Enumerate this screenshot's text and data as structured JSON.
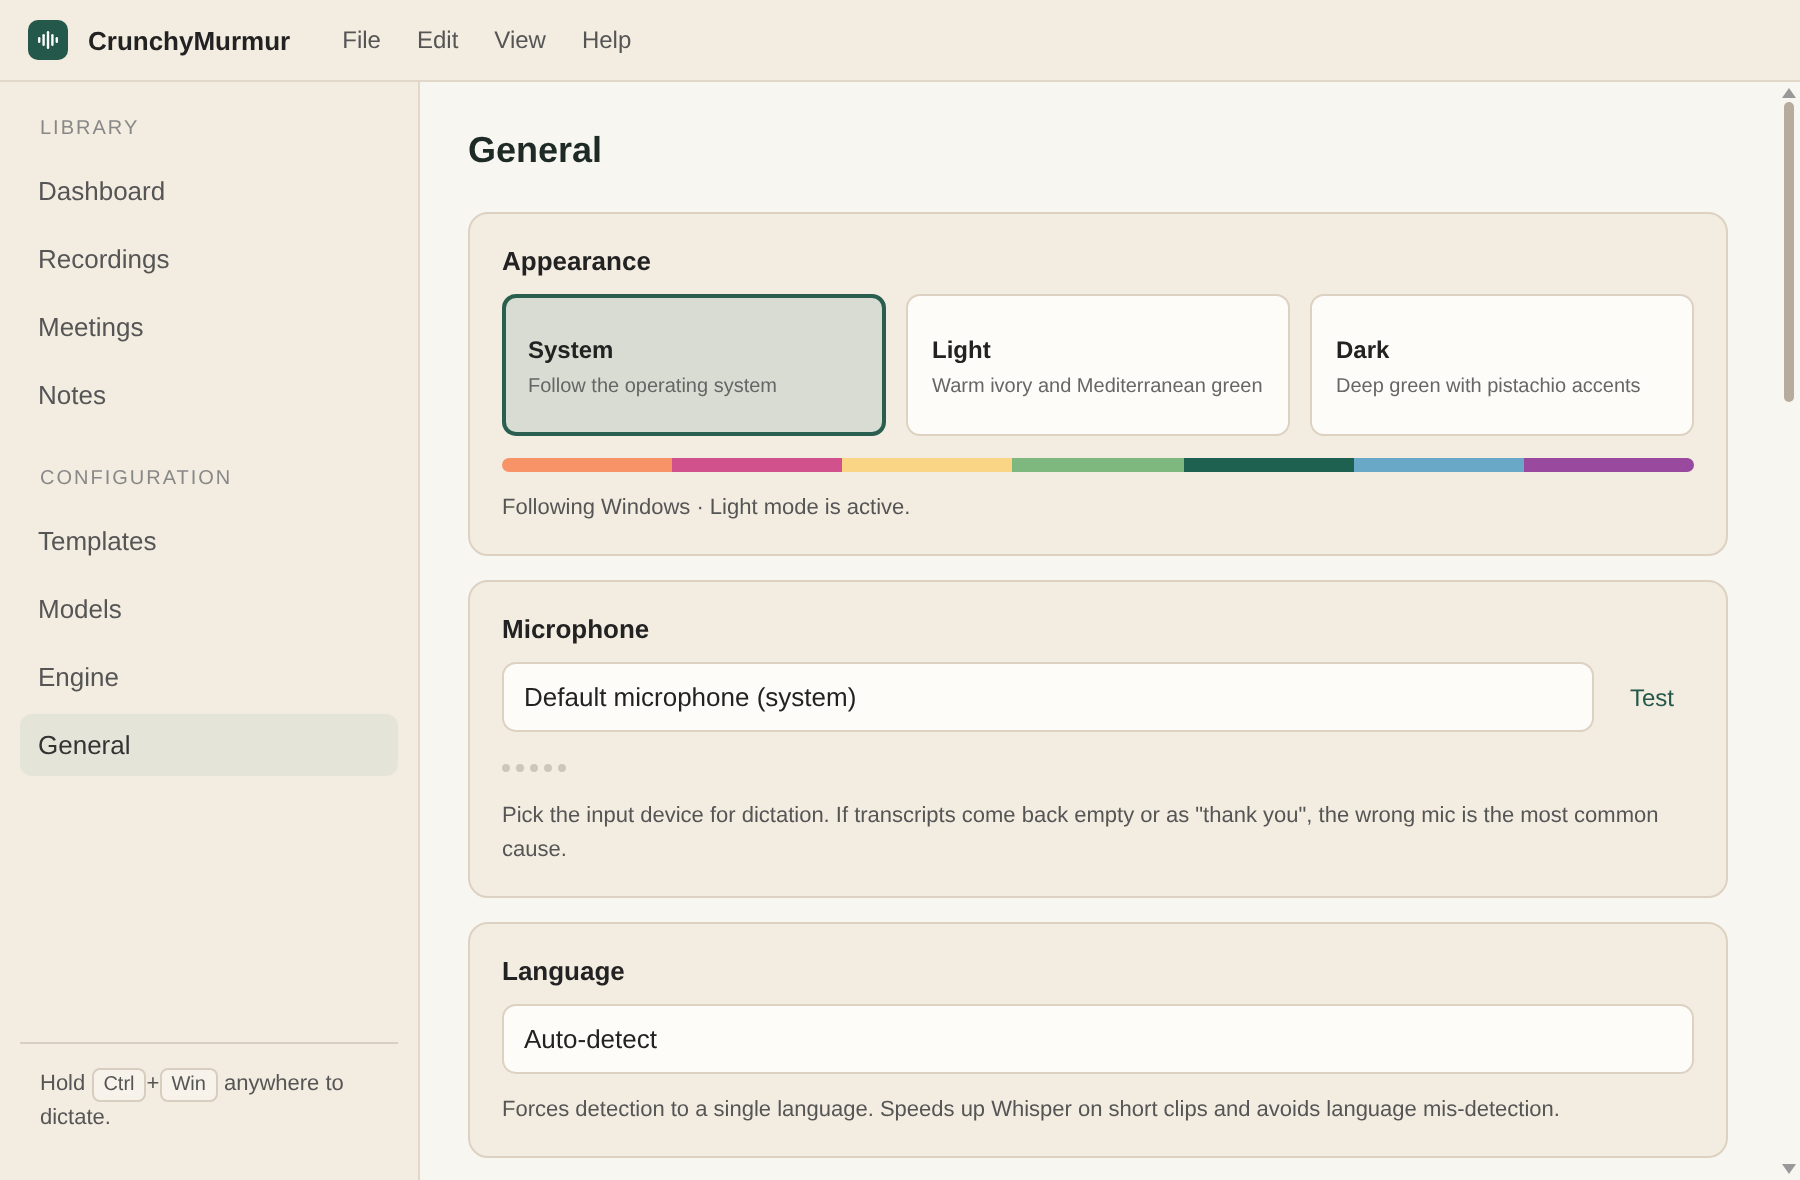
{
  "app": {
    "name": "CrunchyMurmur",
    "menu": [
      "File",
      "Edit",
      "View",
      "Help"
    ]
  },
  "sidebar": {
    "sections": [
      {
        "heading": "LIBRARY",
        "items": [
          {
            "label": "Dashboard",
            "selected": false
          },
          {
            "label": "Recordings",
            "selected": false
          },
          {
            "label": "Meetings",
            "selected": false
          },
          {
            "label": "Notes",
            "selected": false
          }
        ]
      },
      {
        "heading": "CONFIGURATION",
        "items": [
          {
            "label": "Templates",
            "selected": false
          },
          {
            "label": "Models",
            "selected": false
          },
          {
            "label": "Engine",
            "selected": false
          },
          {
            "label": "General",
            "selected": true
          }
        ]
      }
    ],
    "hint": {
      "before": "Hold",
      "keys": [
        "Ctrl",
        "Win"
      ],
      "joiner": "+",
      "after": "anywhere to dictate."
    }
  },
  "page": {
    "title": "General",
    "appearance": {
      "title": "Appearance",
      "options": [
        {
          "title": "System",
          "description": "Follow the operating system",
          "selected": true
        },
        {
          "title": "Light",
          "description": "Warm ivory and Mediterranean green",
          "selected": false
        },
        {
          "title": "Dark",
          "description": "Deep green with pistachio accents",
          "selected": false
        }
      ],
      "palette": [
        {
          "color": "#f79366"
        },
        {
          "color": "#d1518c"
        },
        {
          "color": "#fad585"
        },
        {
          "color": "#7fb87f"
        },
        {
          "color": "#1f6150"
        },
        {
          "color": "#6aa8c8"
        },
        {
          "color": "#9a4a9e"
        }
      ],
      "status": "Following Windows · Light mode is active."
    },
    "microphone": {
      "title": "Microphone",
      "value": "Default microphone (system)",
      "test": "Test",
      "help": "Pick the input device for dictation. If transcripts come back empty or as \"thank you\", the wrong mic is the most common cause."
    },
    "language": {
      "title": "Language",
      "value": "Auto-detect",
      "help": "Forces detection to a single language. Speeds up Whisper on short clips and avoids language mis-detection."
    }
  }
}
